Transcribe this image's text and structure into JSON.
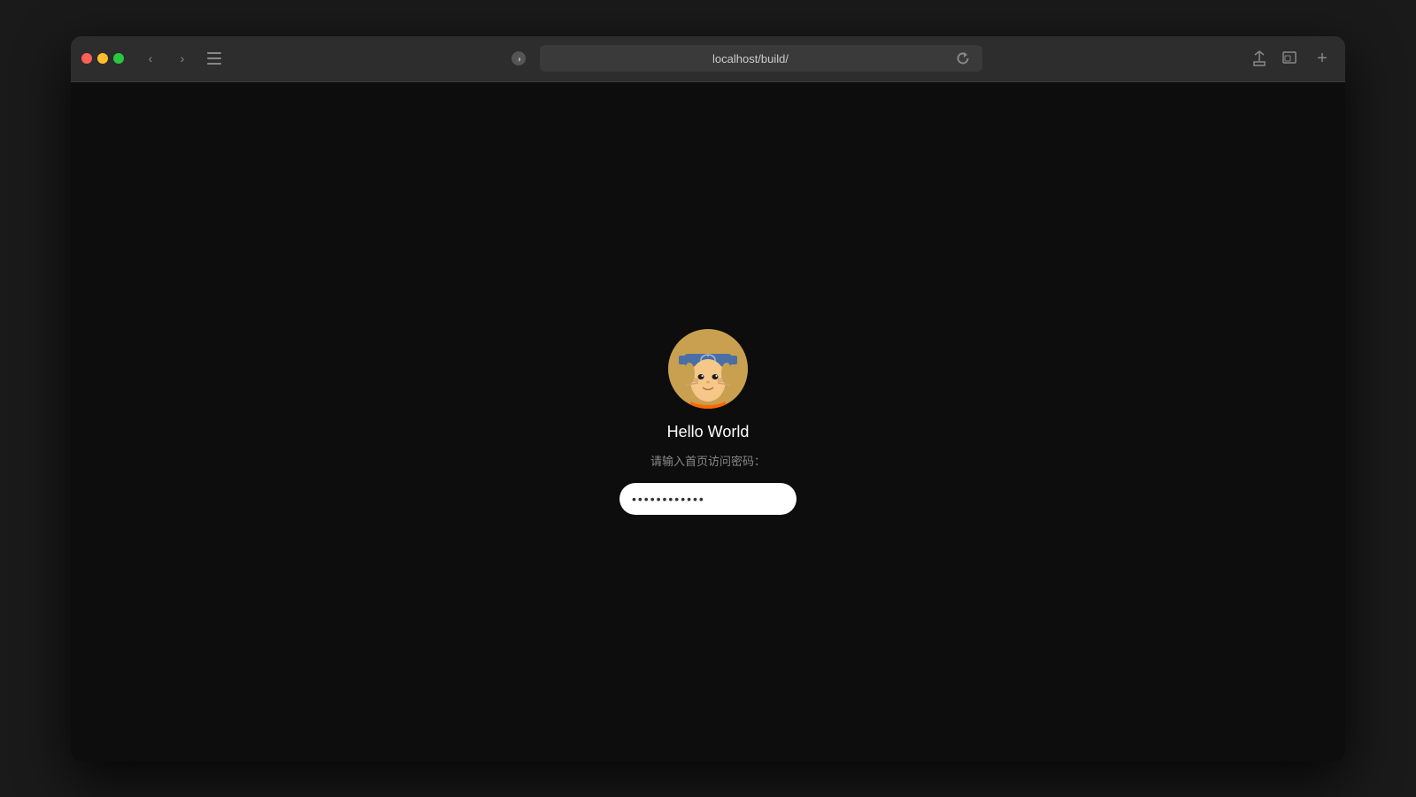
{
  "browser": {
    "url": "localhost/build/",
    "traffic_lights": {
      "close_label": "close",
      "minimize_label": "minimize",
      "maximize_label": "maximize"
    },
    "nav": {
      "back_label": "‹",
      "forward_label": "›"
    },
    "actions": {
      "share_label": "⬆",
      "tab_label": "⧉",
      "add_tab_label": "+"
    }
  },
  "login": {
    "username": "Hello World",
    "prompt": "请输入首页访问密码：",
    "password_placeholder": "············",
    "password_value": "············",
    "submit_label": "→"
  }
}
